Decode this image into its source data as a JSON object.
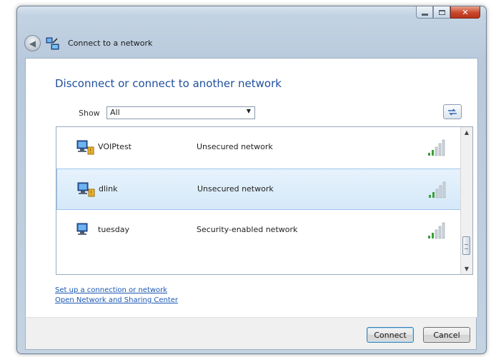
{
  "window": {
    "title": "Connect to a network",
    "icon": "network-connect-icon"
  },
  "main": {
    "heading": "Disconnect or connect to another network",
    "show_label": "Show",
    "show_value": "All"
  },
  "networks": [
    {
      "name": "VOIPtest",
      "status": "Unsecured network",
      "signal": 4,
      "selected": false
    },
    {
      "name": "dlink",
      "status": "Unsecured network",
      "signal": 4,
      "selected": true
    },
    {
      "name": "tuesday",
      "status": "Security-enabled network",
      "signal": 4,
      "selected": false
    }
  ],
  "links": {
    "setup": "Set up a connection or network",
    "sharing": "Open Network and Sharing Center"
  },
  "buttons": {
    "connect": "Connect",
    "cancel": "Cancel"
  },
  "colors": {
    "heading": "#1f4f9d",
    "link": "#1b57b3",
    "selection": "#d5e9f9"
  }
}
